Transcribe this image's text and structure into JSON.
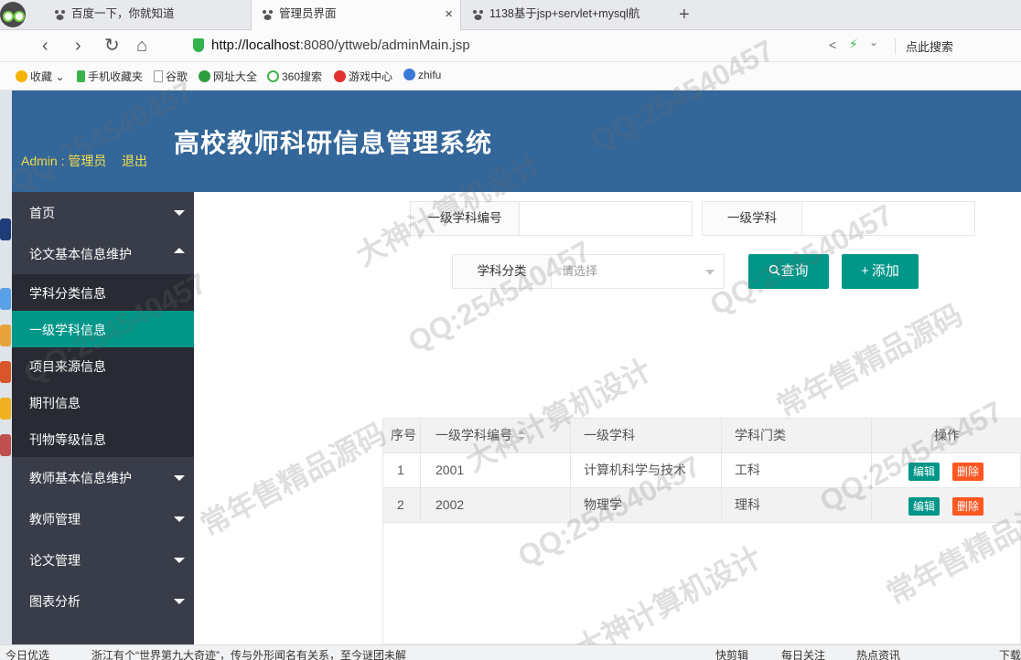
{
  "browser": {
    "tabs": [
      {
        "title": "百度一下，你就知道"
      },
      {
        "title": "管理员界面",
        "close": "×"
      },
      {
        "title": "1138基于jsp+servlet+mysql航"
      }
    ],
    "new_tab": "+",
    "url_host": "http://localhost",
    "url_rest": ":8080/yttweb/adminMain.jsp",
    "search_hint": "点此搜索",
    "bookmarks": [
      "收藏",
      "手机收藏夹",
      "谷歌",
      "网址大全",
      "360搜索",
      "游戏中心",
      "zhifu"
    ]
  },
  "header": {
    "title": "高校教师科研信息管理系统",
    "admin": "Admin : 管理员",
    "logout": "退出"
  },
  "sidebar": {
    "menus": [
      {
        "label": "首页"
      },
      {
        "label": "论文基本信息维护"
      },
      {
        "label": "教师基本信息维护"
      },
      {
        "label": "教师管理"
      },
      {
        "label": "论文管理"
      },
      {
        "label": "图表分析"
      }
    ],
    "subs": [
      {
        "label": "学科分类信息"
      },
      {
        "label": "一级学科信息"
      },
      {
        "label": "项目来源信息"
      },
      {
        "label": "期刊信息"
      },
      {
        "label": "刊物等级信息"
      }
    ]
  },
  "filters": {
    "code_label": "一级学科编号",
    "subject_label": "一级学科",
    "category_label": "学科分类",
    "category_placeholder": "请选择",
    "query_button": "查询",
    "add_button": "添加"
  },
  "table": {
    "headers": [
      "序号",
      "一级学科编号",
      "一级学科",
      "学科门类",
      "操作"
    ],
    "rows": [
      {
        "no": "1",
        "code": "2001",
        "name": "计算机科学与技术",
        "category": "工科"
      },
      {
        "no": "2",
        "code": "2002",
        "name": "物理学",
        "category": "理科"
      }
    ],
    "edit_label": "编辑",
    "delete_label": "删除"
  },
  "watermark": {
    "qq": "QQ:254540457",
    "a": "大神计算机设计",
    "b": "常年售精品源码"
  },
  "statusbar": {
    "left": "今日优选",
    "news": "浙江有个“世界第九大奇迹”，传与外形闻名有关系，至今谜团未解",
    "items": [
      "快剪辑",
      "每日关注",
      "热点资讯",
      "下载"
    ]
  }
}
